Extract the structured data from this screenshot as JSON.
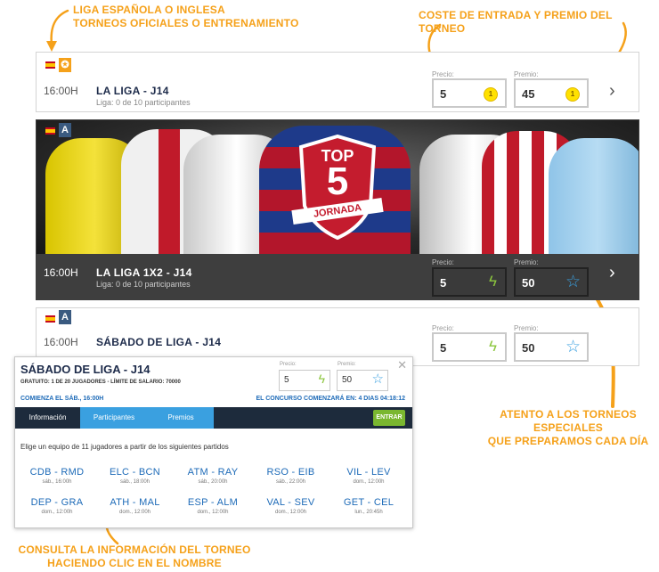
{
  "annotations": {
    "top_left": [
      "LIGA ESPAÑOLA O INGLESA",
      "TORNEOS OFICIALES O ENTRENAMIENTO"
    ],
    "top_right": "COSTE DE ENTRADA  Y PREMIO DEL TORNEO",
    "bottom_right": [
      "ATENTO A LOS TORNEOS ESPECIALES",
      "QUE PREPARAMOS CADA DÍA"
    ],
    "bottom_left": [
      "CONSULTA LA INFORMACIÓN DEL TORNEO",
      "HACIENDO CLIC EN EL NOMBRE"
    ]
  },
  "tournaments": [
    {
      "time": "16:00H",
      "name": "LA LIGA - J14",
      "subtitle": "Liga: 0 de 10 participantes",
      "price_label": "Precio:",
      "price": "5",
      "prize_label": "Premio:",
      "prize": "45",
      "coin_symbol": "1"
    },
    {
      "time": "16:00H",
      "name": "LA LIGA 1X2 - J14",
      "subtitle": "Liga: 0 de 10 participantes",
      "price_label": "Precio:",
      "price": "5",
      "prize_label": "Premio:",
      "prize": "50"
    },
    {
      "time": "16:00H",
      "name": "SÁBADO DE LIGA - J14",
      "subtitle": "",
      "price_label": "Precio:",
      "price": "5",
      "prize_label": "Premio:",
      "prize": "50"
    }
  ],
  "banner": {
    "badge_top": "TOP",
    "badge_number": "5",
    "badge_word": "JORNADA"
  },
  "popup": {
    "title": "SÁBADO DE LIGA - J14",
    "subtitle": "GRATUITO: 1 DE 20 JUGADORES - LÍMITE DE SALARIO: 70000",
    "price_label": "Precio:",
    "price": "5",
    "prize_label": "Premio:",
    "prize": "50",
    "starts": "COMIENZA EL SÁB., 16:00H",
    "countdown": "EL CONCURSO COMENZARÁ EN:  4 DIAS 04:18:12",
    "tabs": [
      "Información",
      "Participantes",
      "Premios"
    ],
    "enter_button": "ENTRAR",
    "instructions": "Elige un equipo de 11 jugadores a partir de los siguientes partidos",
    "matches": [
      {
        "teams": "CDB - RMD",
        "date": "sáb., 16:00h"
      },
      {
        "teams": "ELC - BCN",
        "date": "sáb., 18:00h"
      },
      {
        "teams": "ATM - RAY",
        "date": "sáb., 20:00h"
      },
      {
        "teams": "RSO - EIB",
        "date": "sáb., 22:00h"
      },
      {
        "teams": "VIL - LEV",
        "date": "dom., 12:00h"
      },
      {
        "teams": "DEP - GRA",
        "date": "dom., 12:00h"
      },
      {
        "teams": "ATH - MAL",
        "date": "dom., 12:00h"
      },
      {
        "teams": "ESP - ALM",
        "date": "dom., 12:00h"
      },
      {
        "teams": "VAL - SEV",
        "date": "dom., 12:00h"
      },
      {
        "teams": "GET - CEL",
        "date": "lun., 20:45h"
      }
    ]
  },
  "colors": {
    "accent_orange": "#f5a11a",
    "dark_bar": "#3e3e3e",
    "nav_dark": "#1d2b3c",
    "tab_active": "#3aa0e0",
    "enter_green": "#7ab730",
    "link_blue": "#1e6bb8"
  }
}
